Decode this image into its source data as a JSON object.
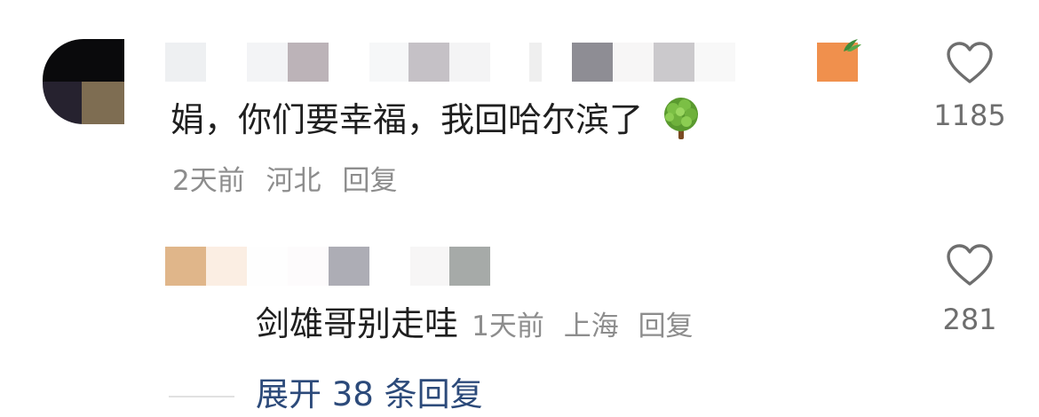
{
  "comment": {
    "text": "娟，你们要幸福，我回哈尔滨了",
    "emoji": "tree-emoji",
    "time": "2天前",
    "location": "河北",
    "reply_label": "回复",
    "like_count": "1185"
  },
  "reply": {
    "text": "剑雄哥别走哇",
    "time": "1天前",
    "location": "上海",
    "reply_label": "回复",
    "like_count": "281"
  },
  "expand": {
    "label": "展开 38 条回复"
  },
  "icons": {
    "like": "heart-outline-icon",
    "emoji": "tree-emoji"
  },
  "colors": {
    "text_primary": "#1f1f1f",
    "text_secondary": "#8d8d8d",
    "link_blue": "#2c4a7a",
    "icon_gray": "#6e6e6e"
  }
}
